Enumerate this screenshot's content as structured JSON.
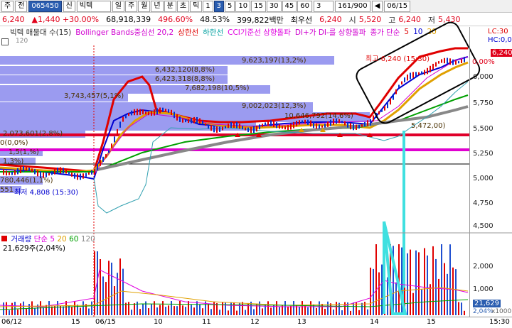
{
  "toolbar": {
    "menu_label": "주",
    "prev_label": "전",
    "stock_code": "065450",
    "search_prefix": "신",
    "stock_name": "빅텍",
    "period_buttons": [
      "일",
      "주",
      "월",
      "년",
      "분",
      "초",
      "틱",
      "1",
      "3",
      "5",
      "10",
      "15",
      "30",
      "45",
      "60"
    ],
    "active_period": "3",
    "interval_value": "3",
    "range_text": "161/900",
    "nav_button": "◀",
    "date_text": "06/15"
  },
  "quote": {
    "price": "6,240",
    "change": "1,440",
    "change_pct": "+30.00%",
    "volume": "68,918,339",
    "turnover_pct": "496.60%",
    "ratio_pct": "48.53%",
    "amount": "399,822백만",
    "broker": "최우선",
    "current": "6,240",
    "open_label": "시",
    "open": "5,520",
    "high_label": "고",
    "high": "6,240",
    "low_label": "저",
    "low": "5,430"
  },
  "legend": {
    "items": [
      {
        "text": "빅텍 매물대 수(15)",
        "color": "#333333"
      },
      {
        "text": "Bollinger Bands중심선 20,2",
        "color": "#d000d0"
      },
      {
        "text": "상한선",
        "color": "#e00000"
      },
      {
        "text": "하한선",
        "color": "#00a0a0"
      },
      {
        "text": "CCI기준선 상향돌파",
        "color": "#e000e0"
      },
      {
        "text": "DI+가 DI-를 상향돌파",
        "color": "#d000d0"
      },
      {
        "text": "종가 단순",
        "color": "#d000d0"
      },
      {
        "text": "5",
        "color": "#e00000"
      },
      {
        "text": "10",
        "color": "#0000d0"
      },
      {
        "text": "20",
        "color": "#e0a000"
      }
    ],
    "small_120": "120",
    "right_top": "LC:30",
    "right_sub": "HC:0,0"
  },
  "price_axis": {
    "ticks": [
      "6,000",
      "5,750",
      "5,500",
      "5,250",
      "5,000",
      "4,750",
      "4,500"
    ],
    "current_tag": "6,240",
    "current_tag_sub": "0,00%",
    "current_color": "#e0001a"
  },
  "volume_profile": [
    {
      "label": "9,623,197(13,2%)"
    },
    {
      "label": "6,432,120(8,8%)"
    },
    {
      "label": "6,423,318(8,8%)"
    },
    {
      "label": "7,682,198(10,5%)"
    },
    {
      "label": "3,743,457(5,1%)"
    },
    {
      "label": "9,002,023(12,3%)"
    },
    {
      "label": "10,646,792(14,6%)"
    },
    {
      "label": "5,472,00)"
    },
    {
      "label": "2,073,601(2,8%)"
    },
    {
      "label": "0(0,0%)"
    },
    {
      "label": "1,5(1,%)"
    },
    {
      "label": "1,3%)"
    },
    {
      "label": "780,446(1,1%)"
    },
    {
      "label": "551"
    }
  ],
  "annotations": {
    "high_label": "최고 6,240 (15:30)",
    "low_label": "최저 4,808 (15:30)"
  },
  "volume_panel": {
    "legend_title": "거래량",
    "legend_ma": "단순",
    "legend_5": "5",
    "legend_20": "20",
    "legend_60": "60",
    "legend_120": "120",
    "legend_value": "21,629주(2,04%)",
    "ticks": [
      "2,000",
      "1,000"
    ],
    "tag_value": "21,629",
    "tag_pct": "2,04%",
    "tag_unit": "x1000"
  },
  "date_axis": {
    "labels": [
      "06/12",
      "15",
      "06/15",
      "10",
      "11",
      "12",
      "13",
      "14",
      "15",
      "15:30"
    ]
  }
}
